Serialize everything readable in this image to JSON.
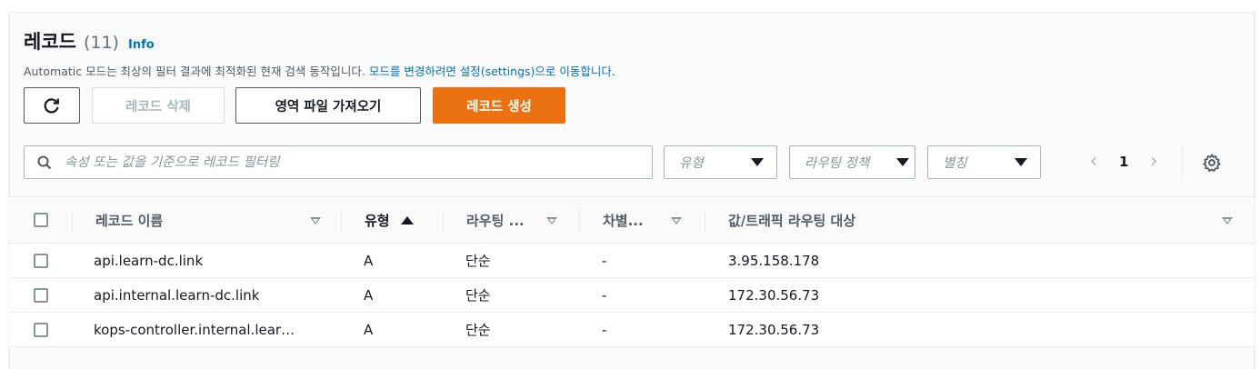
{
  "header": {
    "title": "레코드",
    "count": "(11)",
    "info": "Info",
    "description": "Automatic 모드는 최상의 필터 결과에 최적화된 현재 검색 동작입니다.",
    "description_link": "모드를 변경하려면 설정(settings)으로 이동합니다."
  },
  "toolbar": {
    "refresh_icon": "refresh-icon",
    "delete_label": "레코드 삭제",
    "import_label": "영역 파일 가져오기",
    "create_label": "레코드 생성"
  },
  "filters": {
    "search_placeholder": "속성 또는 값을 기준으로 레코드 필터링",
    "type_placeholder": "유형",
    "routing_placeholder": "라우팅 정책",
    "alias_placeholder": "별칭"
  },
  "pagination": {
    "prev": "‹",
    "page": "1",
    "next": "›"
  },
  "table": {
    "columns": {
      "name": "레코드 이름",
      "type": "유형",
      "routing": "라우팅 ...",
      "diff": "차별...",
      "value": "값/트래픽 라우팅 대상"
    },
    "rows": [
      {
        "name": "api.learn-dc.link",
        "type": "A",
        "routing": "단순",
        "diff": "-",
        "value": "3.95.158.178"
      },
      {
        "name": "api.internal.learn-dc.link",
        "type": "A",
        "routing": "단순",
        "diff": "-",
        "value": "172.30.56.73"
      },
      {
        "name": "kops-controller.internal.lear…",
        "type": "A",
        "routing": "단순",
        "diff": "-",
        "value": "172.30.56.73"
      }
    ]
  },
  "colors": {
    "primary": "#ec7211",
    "link": "#0073bb"
  }
}
